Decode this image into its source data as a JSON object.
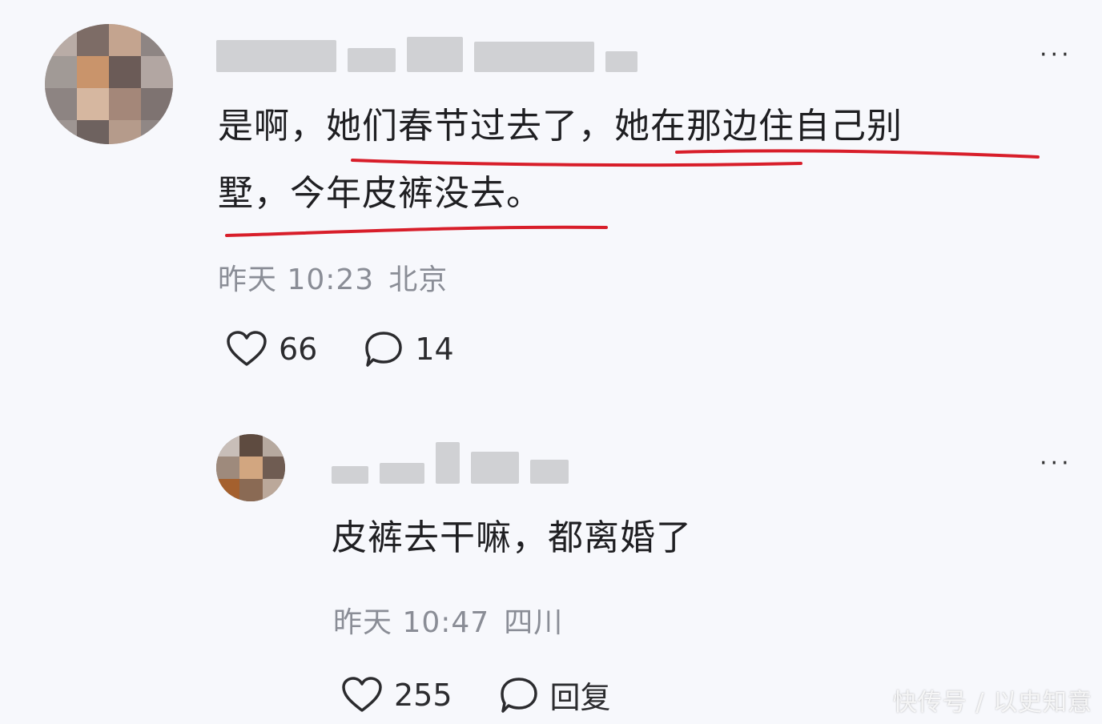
{
  "comments": [
    {
      "text_line1": "是啊，她们春节过去了，她在那边住自己别",
      "text_line2": "墅，今年皮裤没去。",
      "time": "昨天 10:23",
      "location": "北京",
      "likes": "66",
      "replies": "14",
      "more_label": "···"
    },
    {
      "text_line1": "皮裤去干嘛，都离婚了",
      "time": "昨天 10:47",
      "location": "四川",
      "likes": "255",
      "reply_label": "回复",
      "more_label": "···"
    }
  ],
  "watermark": "快传号 / 以史知意",
  "colors": {
    "underline": "#d81e2a",
    "meta": "#8a8d96",
    "background": "#f7f8fc"
  }
}
